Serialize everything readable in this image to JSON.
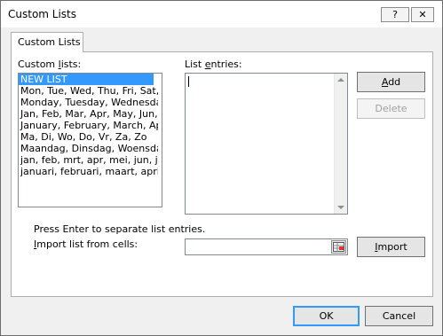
{
  "window": {
    "title": "Custom Lists",
    "help_label": "?",
    "close_label": "✕"
  },
  "tabs": [
    {
      "label": "Custom Lists"
    }
  ],
  "custom_lists": {
    "label_pre": "Custom ",
    "label_u": "l",
    "label_post": "ists:",
    "items": [
      "NEW LIST",
      "Mon, Tue, Wed, Thu, Fri, Sat, S",
      "Monday, Tuesday, Wednesday,",
      "Jan, Feb, Mar, Apr, May, Jun, Ju",
      "January, February, March, Apri",
      "Ma, Di, Wo, Do, Vr, Za, Zo",
      "Maandag, Dinsdag, Woensdag",
      "jan, feb, mrt, apr, mei, jun, jul,",
      "januari, februari, maart, april, r"
    ],
    "selected_index": 0
  },
  "list_entries": {
    "label_pre": "List ",
    "label_u": "e",
    "label_post": "ntries:",
    "value": ""
  },
  "buttons": {
    "add": {
      "u": "A",
      "rest": "dd"
    },
    "delete": "Delete",
    "import": {
      "u": "I",
      "rest": "mport"
    },
    "ok": "OK",
    "cancel": "Cancel"
  },
  "hint": "Press Enter to separate list entries.",
  "import_label": {
    "u": "I",
    "rest": "mport list from cells:"
  },
  "import_value": ""
}
